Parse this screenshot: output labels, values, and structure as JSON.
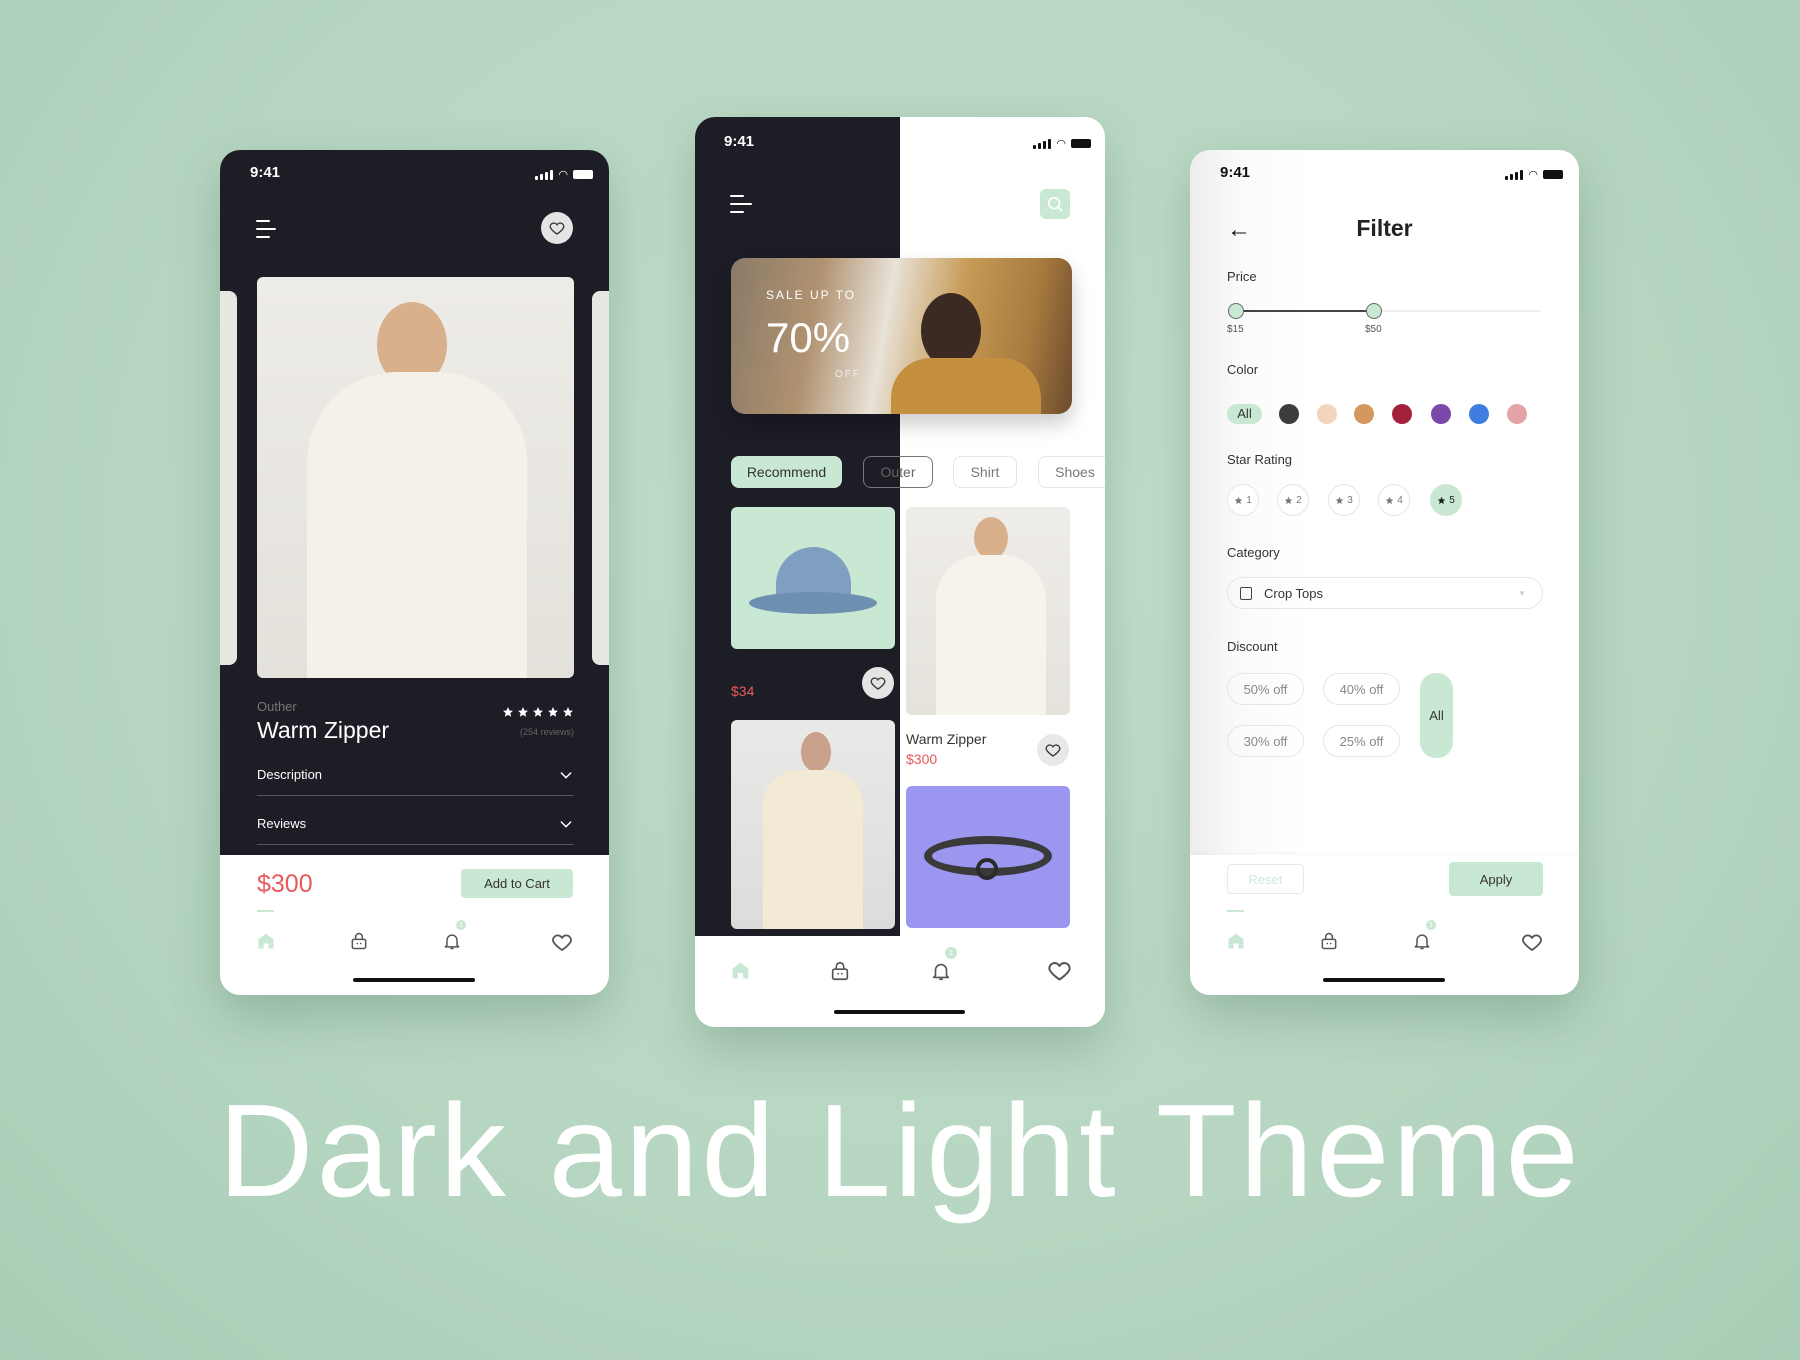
{
  "headline": "Dark and Light Theme",
  "colors": {
    "accent": "#c9e8d4",
    "price": "#e85a5a",
    "dark": "#1c1d25"
  },
  "status_bar": {
    "time": "9:41"
  },
  "detail_screen": {
    "category": "Outher",
    "title": "Warm Zipper",
    "rating": 5,
    "reviews": "(254 reviews)",
    "sections": [
      "Description",
      "Reviews"
    ],
    "price": "$300",
    "add_to_cart": "Add to Cart",
    "notification_count": "1"
  },
  "home_screen": {
    "banner": {
      "line1": "SALE UP TO",
      "line2": "70%",
      "line3": "OFF"
    },
    "tabs": [
      "Recommend",
      "Outer",
      "Shirt",
      "Shoes"
    ],
    "active_tab": "Recommend",
    "products": [
      {
        "name": "",
        "price": "$34"
      },
      {
        "name": "Warm Zipper",
        "price": "$300"
      }
    ],
    "notification_count": "1"
  },
  "filter_screen": {
    "title": "Filter",
    "price_label": "Price",
    "price_min": "$15",
    "price_max": "$50",
    "color_label": "Color",
    "color_all": "All",
    "colors": [
      "#3d3b3b",
      "#f3d5bd",
      "#d4975d",
      "#a3203a",
      "#7a48a8",
      "#3f7ee0",
      "#e2a4a6"
    ],
    "star_label": "Star Rating",
    "stars": [
      "1",
      "2",
      "3",
      "4",
      "5"
    ],
    "selected_star": "5",
    "category_label": "Category",
    "category_value": "Crop Tops",
    "discount_label": "Discount",
    "discounts": [
      "50% off",
      "40% off",
      "30% off",
      "25% off"
    ],
    "discount_all": "All",
    "reset": "Reset",
    "apply": "Apply",
    "notification_count": "1"
  },
  "icons": [
    "menu-icon",
    "heart-icon",
    "search-icon",
    "home-icon",
    "bag-icon",
    "bell-icon",
    "chevron-down-icon",
    "back-arrow-icon",
    "star-icon",
    "shirt-icon"
  ]
}
